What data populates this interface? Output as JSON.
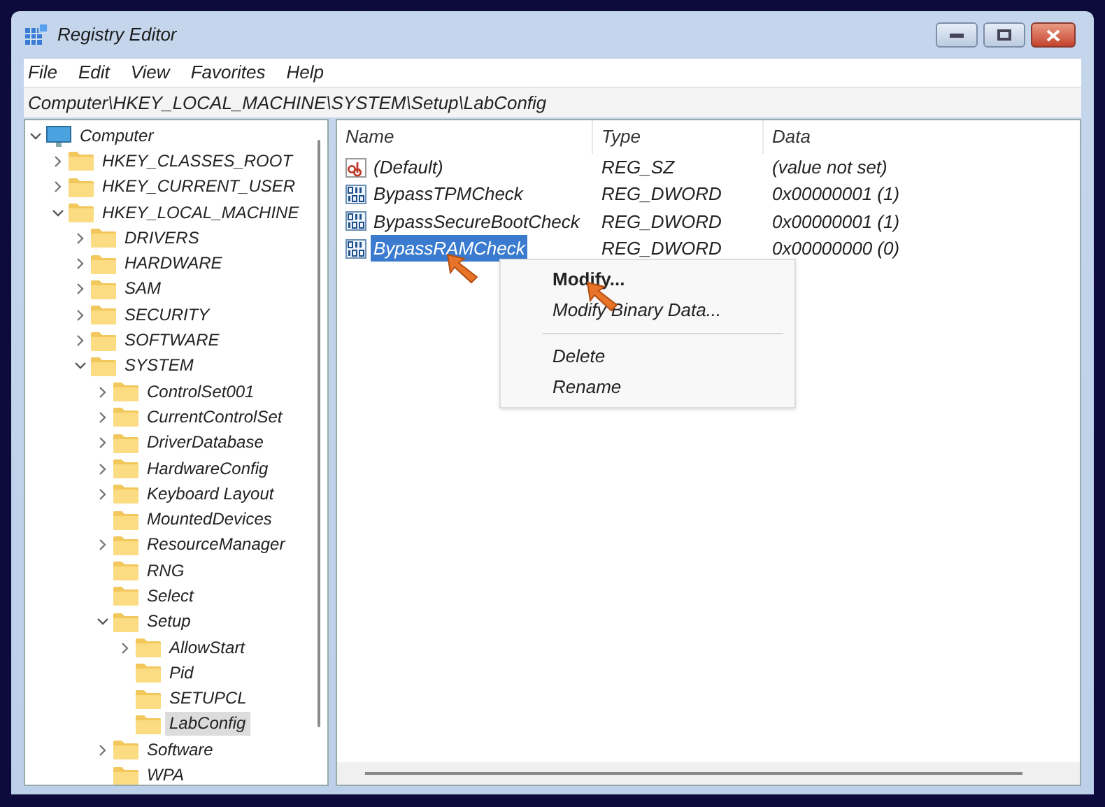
{
  "window": {
    "title": "Registry Editor"
  },
  "menu": [
    "File",
    "Edit",
    "View",
    "Favorites",
    "Help"
  ],
  "address": "Computer\\HKEY_LOCAL_MACHINE\\SYSTEM\\Setup\\LabConfig",
  "tree": [
    {
      "label": "Computer",
      "kind": "computer",
      "expanded": true,
      "selected": false,
      "children": [
        {
          "label": "HKEY_CLASSES_ROOT",
          "expanded": false,
          "selected": false
        },
        {
          "label": "HKEY_CURRENT_USER",
          "expanded": false,
          "selected": false
        },
        {
          "label": "HKEY_LOCAL_MACHINE",
          "expanded": true,
          "selected": false,
          "children": [
            {
              "label": "DRIVERS",
              "expanded": false,
              "selected": false
            },
            {
              "label": "HARDWARE",
              "expanded": false,
              "selected": false
            },
            {
              "label": "SAM",
              "expanded": false,
              "selected": false
            },
            {
              "label": "SECURITY",
              "expanded": false,
              "selected": false
            },
            {
              "label": "SOFTWARE",
              "expanded": false,
              "selected": false
            },
            {
              "label": "SYSTEM",
              "expanded": true,
              "selected": false,
              "children": [
                {
                  "label": "ControlSet001",
                  "expanded": false,
                  "selected": false
                },
                {
                  "label": "CurrentControlSet",
                  "expanded": false,
                  "selected": false
                },
                {
                  "label": "DriverDatabase",
                  "expanded": false,
                  "selected": false
                },
                {
                  "label": "HardwareConfig",
                  "expanded": false,
                  "selected": false
                },
                {
                  "label": "Keyboard Layout",
                  "expanded": false,
                  "selected": false
                },
                {
                  "label": "MountedDevices",
                  "selected": false
                },
                {
                  "label": "ResourceManager",
                  "expanded": false,
                  "selected": false
                },
                {
                  "label": "RNG",
                  "selected": false
                },
                {
                  "label": "Select",
                  "selected": false
                },
                {
                  "label": "Setup",
                  "expanded": true,
                  "selected": false,
                  "children": [
                    {
                      "label": "AllowStart",
                      "expanded": false,
                      "selected": false
                    },
                    {
                      "label": "Pid",
                      "selected": false
                    },
                    {
                      "label": "SETUPCL",
                      "selected": false
                    },
                    {
                      "label": "LabConfig",
                      "selected": true
                    }
                  ]
                },
                {
                  "label": "Software",
                  "expanded": false,
                  "selected": false
                },
                {
                  "label": "WPA",
                  "selected": false
                }
              ]
            }
          ]
        }
      ]
    }
  ],
  "columns": [
    "Name",
    "Type",
    "Data"
  ],
  "values": [
    {
      "kind": "string",
      "name": "(Default)",
      "type": "REG_SZ",
      "data": "(value not set)",
      "selected": false
    },
    {
      "kind": "binary",
      "name": "BypassTPMCheck",
      "type": "REG_DWORD",
      "data": "0x00000001 (1)",
      "selected": false
    },
    {
      "kind": "binary",
      "name": "BypassSecureBootCheck",
      "type": "REG_DWORD",
      "data": "0x00000001 (1)",
      "selected": false
    },
    {
      "kind": "binary",
      "name": "BypassRAMCheck",
      "type": "REG_DWORD",
      "data": "0x00000000 (0)",
      "selected": true
    }
  ],
  "context_menu": [
    {
      "kind": "item",
      "label": "Modify...",
      "default": true
    },
    {
      "kind": "item",
      "label": "Modify Binary Data...",
      "default": false
    },
    {
      "kind": "separator"
    },
    {
      "kind": "item",
      "label": "Delete",
      "default": false
    },
    {
      "kind": "item",
      "label": "Rename",
      "default": false
    }
  ]
}
